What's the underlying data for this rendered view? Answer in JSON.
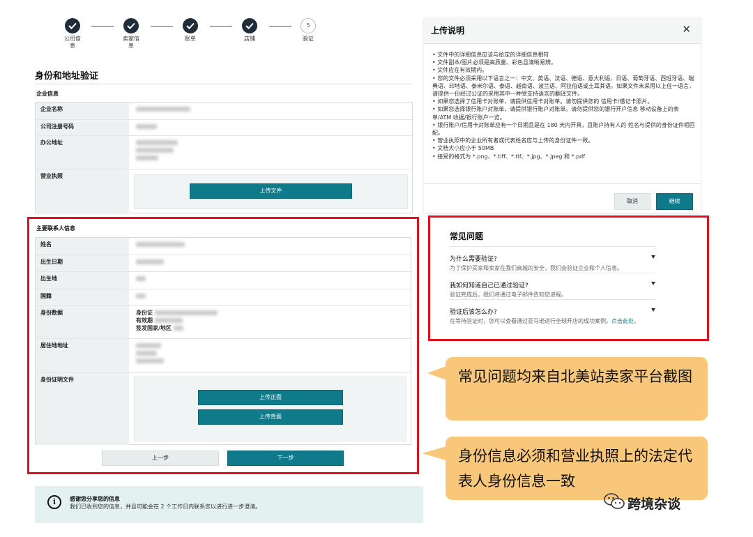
{
  "steps": [
    {
      "label": "公司信\n息",
      "status": "done"
    },
    {
      "label": "卖家信\n息",
      "status": "done"
    },
    {
      "label": "账单",
      "status": "done"
    },
    {
      "label": "店铺",
      "status": "done"
    },
    {
      "label": "验证",
      "status": "current",
      "number": "5"
    }
  ],
  "page_title": "身份和地址验证",
  "company": {
    "section_label": "企业信息",
    "rows": {
      "name": "企业名称",
      "reg_no": "公司注册号码",
      "address": "办公地址",
      "license": "营业执照"
    },
    "upload_button": "上传文件"
  },
  "contact": {
    "section_label": "主要联系人信息",
    "rows": {
      "name": "姓名",
      "dob": "出生日期",
      "birthplace": "出生地",
      "nationality": "国籍",
      "id_data": "身份数据",
      "residence": "居住地地址",
      "id_docs": "身份证明文件"
    },
    "id_fields": {
      "id": "身份证",
      "expiry": "有效期",
      "country": "签发国家/地区"
    },
    "upload_front": "上传正面",
    "upload_back": "上传背面"
  },
  "nav": {
    "prev": "上一步",
    "next": "下一步"
  },
  "info_bar": {
    "icon": "i",
    "title": "感谢您分享您的信息",
    "text": "我们已收到您的信息，并且可能会在 2 个工作日内联系您以进行进一步澄清。"
  },
  "upload_panel": {
    "title": "上传说明",
    "close": "✕",
    "bullets": [
      "• 文件中的详细信息应该与给定的详细信息相符",
      "• 文件副本/图片必须是高质量、彩色且清晰易辨。",
      "• 文件应在有效期内。",
      "• 您的文件必须采用以下语言之一：中文、英语、法语、德语、意大利语、日语、葡萄牙语、西班牙语、瑞典语、印地语、泰米尔语、泰语、越南语、波兰语、阿拉伯语或土耳其语。如果文件未采用以上任一语言，请提供一份经过公证的采用其中一种受支持语言的翻译文件。",
      "• 如果您选择了信用卡对账单，请提供信用卡对账单。请勿提供您的 信用卡/借记卡照片。",
      "• 如果您选择银行账户对账单，请提供银行账户对账单。请勿提供您的银行开户信息 移动设备上的表单/ATM 收据/银行账户一览。",
      "• 银行账户/信用卡对账单应有一个日期且是在 180 天内开具，且账户持有人的 姓名与提供的身份证件相匹配。",
      "• 营业执照中的企业所有者或代表姓名应与上传的身份证件一致。",
      "• 文档大小应小于 50MB",
      "• 接受的格式为 *.png、*.tiff、*.tif、*.jpg、*.jpeg 和 *.pdf"
    ],
    "cancel": "取消",
    "continue": "继续"
  },
  "faq": {
    "title": "常见问题",
    "items": [
      {
        "q": "为什么需要验证?",
        "a": "为了保护买家和卖家在我们商城的安全，我们会验证企业和个人信息。",
        "link": ""
      },
      {
        "q": "我如何知道自己已通过验证?",
        "a": "验证完成后，我们将通过电子邮件告知您进程。",
        "link": ""
      },
      {
        "q": "验证后该怎么办?",
        "a": "在等待验证时，您可以查看通过亚马逊进行全球开店的成功案例。",
        "link": "点击此处。"
      }
    ]
  },
  "callouts": {
    "faq_note": "常见问题均来自北美站卖家平台截图",
    "id_note": "身份信息必须和营业执照上的法定代表人身份信息一致"
  },
  "watermark": "跨境杂谈",
  "colors": {
    "accent": "#0f7a8a",
    "highlight": "#e4101b",
    "callout": "#f9c77a"
  }
}
